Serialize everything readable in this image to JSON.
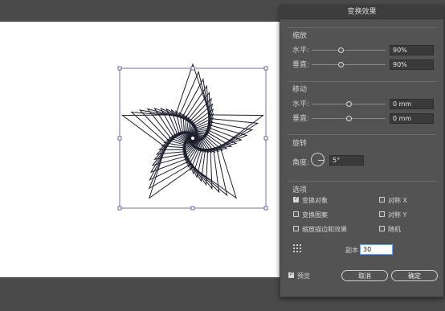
{
  "dialog": {
    "title": "变换效果",
    "scale": {
      "title": "缩放",
      "horizontal_label": "水平:",
      "horizontal_value": "90%",
      "horizontal_level": 0.4,
      "vertical_label": "垂直:",
      "vertical_value": "90%",
      "vertical_level": 0.4
    },
    "move": {
      "title": "移动",
      "horizontal_label": "水平:",
      "horizontal_value": "0 mm",
      "horizontal_level": 0.5,
      "vertical_label": "垂直:",
      "vertical_value": "0 mm",
      "vertical_level": 0.5
    },
    "rotate": {
      "title": "旋转",
      "angle_label": "角度:",
      "angle_value": "5°"
    },
    "options": {
      "title": "选项",
      "items": [
        {
          "label": "变换对象",
          "checked": true
        },
        {
          "label": "对称 X",
          "checked": false
        },
        {
          "label": "变换图案",
          "checked": false
        },
        {
          "label": "对称 Y",
          "checked": false
        },
        {
          "label": "缩放描边和效果",
          "checked": false
        },
        {
          "label": "随机",
          "checked": false
        }
      ],
      "copies_label": "副本",
      "copies_value": "30"
    },
    "preview_label": "预览",
    "preview_checked": true,
    "cancel_label": "取消",
    "ok_label": "确定"
  },
  "colors": {
    "bounding_box": "#4d4d9a",
    "stroke": "#1e1e2e",
    "canvas": "#4a4a4a",
    "dialog_bg": "#535353"
  }
}
